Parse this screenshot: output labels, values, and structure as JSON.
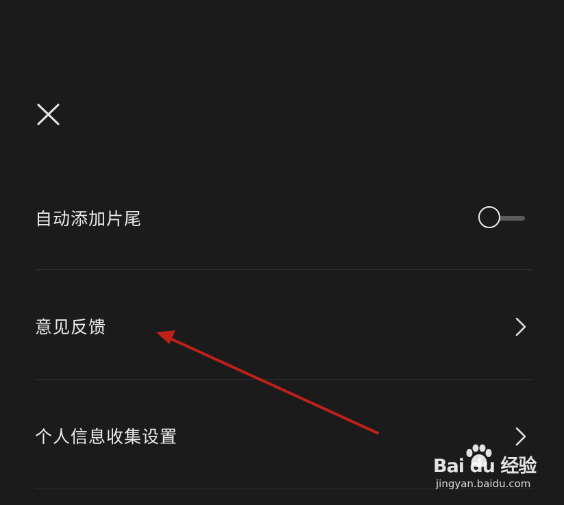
{
  "header": {
    "close_icon": "close-icon"
  },
  "settings": {
    "items": [
      {
        "label": "自动添加片尾",
        "control": "toggle",
        "toggle_on": false
      },
      {
        "label": "意见反馈",
        "control": "chevron-right-icon"
      },
      {
        "label": "个人信息收集设置",
        "control": "chevron-right-icon"
      }
    ]
  },
  "annotation": {
    "arrow_color": "#c0201a"
  },
  "watermark": {
    "brand": "Bai du 经验",
    "url": "jingyan.baidu.com"
  },
  "colors": {
    "background": "#1b1b1b",
    "text": "#ececec",
    "divider": "#2f2f2f"
  }
}
